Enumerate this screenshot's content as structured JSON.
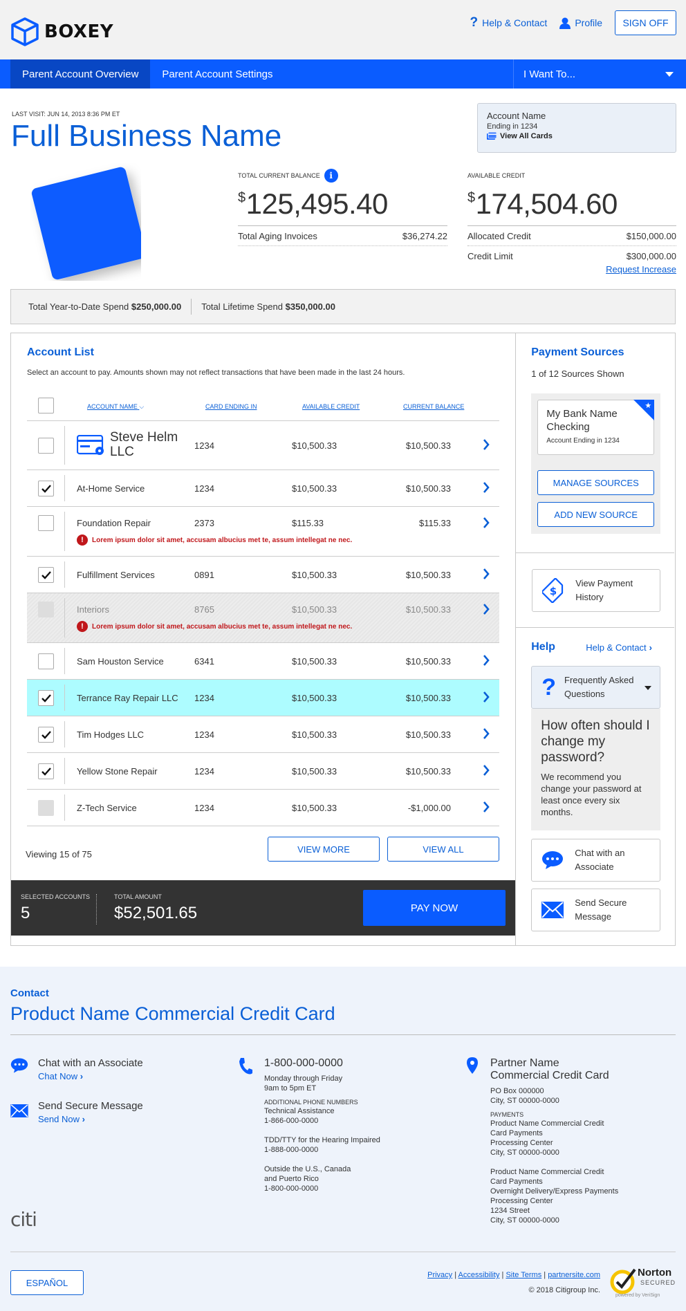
{
  "header": {
    "brand": "BOXEY",
    "help_label": "Help & Contact",
    "profile_label": "Profile",
    "signoff_label": "SIGN OFF"
  },
  "nav": {
    "tabs": [
      {
        "label": "Parent Account Overview"
      },
      {
        "label": "Parent Account Settings"
      }
    ],
    "dropdown_label": "I Want To..."
  },
  "summary": {
    "last_visit": "LAST VISIT: JUN 14, 2013 8:36 PM ET",
    "business_name": "Full Business Name",
    "account_box": {
      "name": "Account Name",
      "ending": "Ending in 1234",
      "view_all": "View All Cards"
    },
    "total_balance_label": "TOTAL CURRENT BALANCE",
    "currency_symbol": "$",
    "total_balance": "125,495.40",
    "aging_label": "Total Aging Invoices",
    "aging_value": "$36,274.22",
    "available_label": "AVAILABLE CREDIT",
    "available_value": "174,504.60",
    "allocated_label": "Allocated Credit",
    "allocated_value": "$150,000.00",
    "limit_label": "Credit Limit",
    "limit_value": "$300,000.00",
    "request_increase": "Request Increase"
  },
  "spend": {
    "ytd_label": "Total Year-to-Date Spend",
    "ytd_value": "$250,000.00",
    "lifetime_label": "Total Lifetime Spend",
    "lifetime_value": "$350,000.00"
  },
  "account_list": {
    "title": "Account List",
    "description": "Select an account to pay. Amounts shown may not reflect transactions that have been made in the last 24 hours.",
    "columns": {
      "name": "ACCOUNT NAME",
      "card": "CARD ENDING IN",
      "available": "AVAILABLE CREDIT",
      "balance": "CURRENT BALANCE"
    },
    "rows": [
      {
        "name": "Steve Helm LLC",
        "card": "1234",
        "available": "$10,500.33",
        "balance": "$10,500.33",
        "checked": false
      },
      {
        "name": "At-Home Service",
        "card": "1234",
        "available": "$10,500.33",
        "balance": "$10,500.33",
        "checked": true
      },
      {
        "name": "Foundation Repair",
        "card": "2373",
        "available": "$115.33",
        "balance": "$115.33",
        "checked": false,
        "error": "Lorem ipsum dolor sit amet, accusam albucius met te, assum intellegat ne nec."
      },
      {
        "name": "Fulfillment Services",
        "card": "0891",
        "available": "$10,500.33",
        "balance": "$10,500.33",
        "checked": true
      },
      {
        "name": "Interiors",
        "card": "8765",
        "available": "$10,500.33",
        "balance": "$10,500.33",
        "checked": false,
        "disabled": true,
        "error": "Lorem ipsum dolor sit amet, accusam albucius met te, assum intellegat ne nec."
      },
      {
        "name": "Sam Houston Service",
        "card": "6341",
        "available": "$10,500.33",
        "balance": "$10,500.33",
        "checked": false
      },
      {
        "name": "Terrance Ray Repair LLC",
        "card": "1234",
        "available": "$10,500.33",
        "balance": "$10,500.33",
        "checked": true,
        "highlight": true
      },
      {
        "name": "Tim Hodges LLC",
        "card": "1234",
        "available": "$10,500.33",
        "balance": "$10,500.33",
        "checked": true
      },
      {
        "name": "Yellow Stone Repair",
        "card": "1234",
        "available": "$10,500.33",
        "balance": "$10,500.33",
        "checked": true
      },
      {
        "name": "Z-Tech Service",
        "card": "1234",
        "available": "$10,500.33",
        "balance": "-$1,000.00",
        "checked": false,
        "disabled_checkbox": true
      }
    ],
    "viewing": "Viewing 15 of 75",
    "view_more": "VIEW MORE",
    "view_all": "VIEW ALL"
  },
  "pay_bar": {
    "selected_label": "SELECTED ACCOUNTS",
    "selected_value": "5",
    "total_label": "TOTAL AMOUNT",
    "total_value": "$52,501.65",
    "pay_now": "PAY NOW"
  },
  "payment_sources": {
    "title": "Payment Sources",
    "count": "1 of 12 Sources Shown",
    "bank_name": "My Bank Name Checking",
    "bank_ending": "Account Ending in 1234",
    "manage": "MANAGE SOURCES",
    "add_new": "ADD NEW SOURCE",
    "view_history": "View Payment History"
  },
  "help": {
    "title": "Help",
    "link": "Help & Contact",
    "faq_label": "Frequently Asked Questions",
    "question": "How often should I change my password?",
    "answer": "We recommend you change your password at least once every six months.",
    "chat": "Chat with an Associate",
    "secure": "Send Secure Message"
  },
  "contact": {
    "label": "Contact",
    "title": "Product Name Commercial Credit Card",
    "chat_heading": "Chat with an Associate",
    "chat_link": "Chat Now",
    "message_heading": "Send Secure Message",
    "message_link": "Send Now",
    "phone": "1-800-000-0000",
    "hours_1": "Monday through Friday",
    "hours_2": "9am to 5pm ET",
    "additional_label": "ADDITIONAL PHONE NUMBERS",
    "tech_label": "Technical Assistance",
    "tech_phone": "1-866-000-0000",
    "tdd_label": "TDD/TTY for the Hearing Impaired",
    "tdd_phone": "1-888-000-0000",
    "outside_1": "Outside the U.S., Canada",
    "outside_2": "and Puerto Rico",
    "outside_phone": "1-800-000-0000",
    "partner_1": "Partner Name",
    "partner_2": "Commercial Credit Card",
    "po_box": "PO Box 000000",
    "city_1": "City, ST 00000-0000",
    "payments_label": "PAYMENTS",
    "pay_1": "Product Name Commercial Credit",
    "pay_2": "Card Payments",
    "pay_3": "Processing Center",
    "pay_4": "City, ST 00000-0000",
    "ovn_1": "Product Name Commercial Credit",
    "ovn_2": "Card Payments",
    "ovn_3": "Overnight Delivery/Express Payments",
    "ovn_4": "Processing Center",
    "ovn_5": "1234 Street",
    "ovn_6": "City, ST 00000-0000",
    "brand": "citi"
  },
  "footer": {
    "espanol": "ESPAÑOL",
    "privacy": "Privacy",
    "accessibility": "Accessibility",
    "site_terms": "Site Terms",
    "partnersite": "partnersite.com",
    "separator": "|",
    "copyright": "© 2018 Citigroup Inc.",
    "norton_1": "Norton",
    "norton_2": "SECURED",
    "norton_3": "powered by VeriSign"
  },
  "colors": {
    "primary": "#0a5cff",
    "link": "#0a5fd6",
    "error": "#c0171b",
    "highlight_row": "#adfcff",
    "pay_bar": "#333333"
  }
}
